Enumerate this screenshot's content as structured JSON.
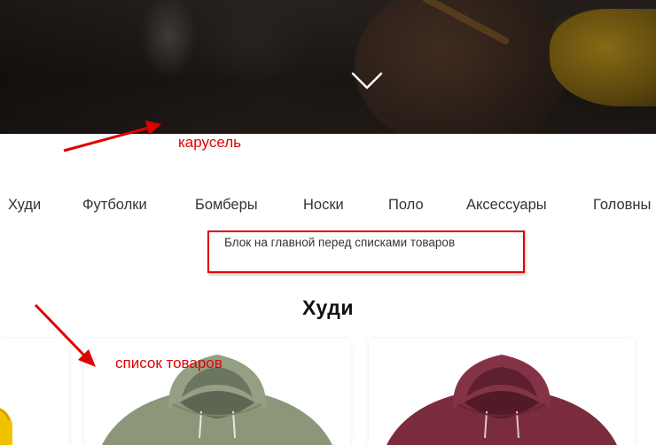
{
  "hero": {
    "next_icon": "chevron-down-icon"
  },
  "annotations": {
    "carousel_label": "карусель",
    "block_label": "Блок на главной перед списками товаров",
    "products_label": "список товаров",
    "color": "#e00000"
  },
  "categories": {
    "items": [
      {
        "label": "Худи"
      },
      {
        "label": "Футболки"
      },
      {
        "label": "Бомберы"
      },
      {
        "label": "Носки"
      },
      {
        "label": "Поло"
      },
      {
        "label": "Аксессуары"
      },
      {
        "label": "Головны"
      }
    ]
  },
  "section": {
    "title": "Худи",
    "products": [
      {
        "image": "yellow-hoodie-image",
        "color": "#f2c200"
      },
      {
        "image": "olive-hoodie-image",
        "color": "#8a9577"
      },
      {
        "image": "burgundy-hoodie-image",
        "color": "#7b2d3f"
      }
    ]
  }
}
